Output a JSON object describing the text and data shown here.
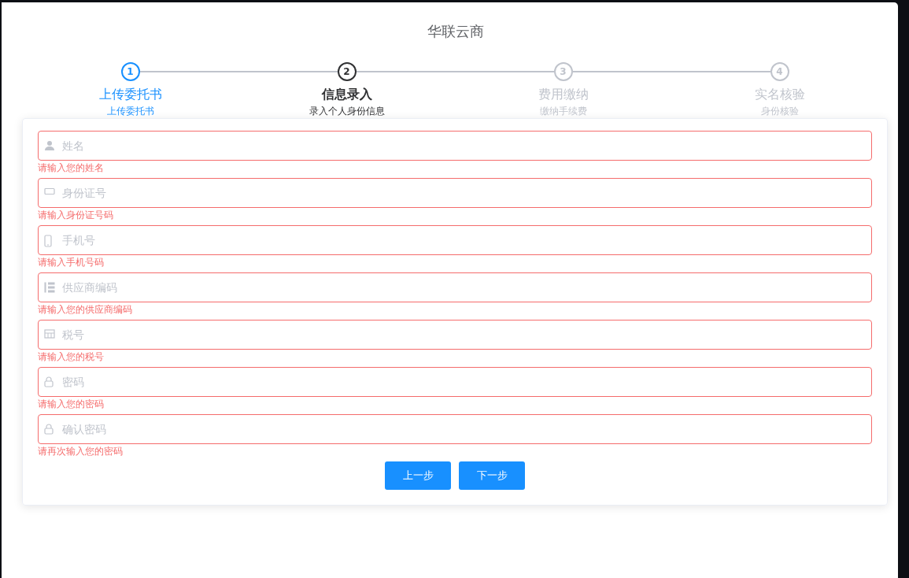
{
  "window": {
    "title": "华联云商"
  },
  "steps": [
    {
      "number": "1",
      "title": "上传委托书",
      "description": "上传委托书",
      "done": true,
      "current": false
    },
    {
      "number": "2",
      "title": "信息录入",
      "description": "录入个人身份信息",
      "done": false,
      "current": true
    },
    {
      "number": "3",
      "title": "费用缴纳",
      "description": "缴纳手续费",
      "done": false,
      "current": false
    },
    {
      "number": "4",
      "title": "实名核验",
      "description": "身份核验",
      "done": false,
      "current": false
    }
  ],
  "form": {
    "fields": [
      {
        "kind": "user",
        "placeholder": "姓名",
        "invalid": true,
        "error": "请输入您的姓名"
      },
      {
        "kind": "card",
        "placeholder": "身份证号",
        "invalid": true,
        "error": "请输入身份证号码"
      },
      {
        "kind": "phone",
        "placeholder": "手机号",
        "invalid": true,
        "error": "请输入手机号码"
      },
      {
        "kind": "list",
        "placeholder": "供应商编码",
        "invalid": true,
        "error": "请输入您的供应商编码"
      },
      {
        "kind": "grid",
        "placeholder": "税号",
        "invalid": true,
        "error": "请输入您的税号"
      },
      {
        "kind": "lock",
        "placeholder": "密码",
        "invalid": true,
        "error": "请输入您的密码"
      },
      {
        "kind": "lock",
        "placeholder": "确认密码",
        "invalid": true,
        "error": "请再次输入您的密码"
      }
    ],
    "buttons": [
      {
        "label": "上一步"
      },
      {
        "label": "下一步"
      }
    ]
  }
}
